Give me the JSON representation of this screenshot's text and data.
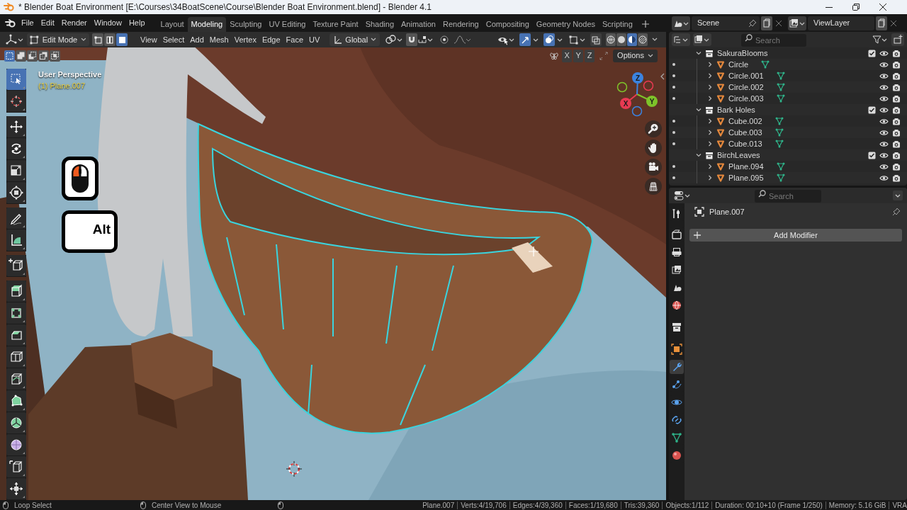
{
  "window": {
    "title": "* Blender Boat Environment [E:\\Courses\\34BoatScene\\Course\\Blender Boat Environment.blend] - Blender 4.1"
  },
  "menu": [
    "File",
    "Edit",
    "Render",
    "Window",
    "Help"
  ],
  "workspaces": [
    {
      "label": "Layout",
      "selected": false
    },
    {
      "label": "Modeling",
      "selected": true
    },
    {
      "label": "Sculpting",
      "selected": false
    },
    {
      "label": "UV Editing",
      "selected": false
    },
    {
      "label": "Texture Paint",
      "selected": false
    },
    {
      "label": "Shading",
      "selected": false
    },
    {
      "label": "Animation",
      "selected": false
    },
    {
      "label": "Rendering",
      "selected": false
    },
    {
      "label": "Compositing",
      "selected": false
    },
    {
      "label": "Geometry Nodes",
      "selected": false
    },
    {
      "label": "Scripting",
      "selected": false
    }
  ],
  "scene": {
    "name": "Scene"
  },
  "view_layer": {
    "name": "ViewLayer"
  },
  "viewport_header": {
    "mode": "Edit Mode",
    "select_modes": [
      {
        "selected": false
      },
      {
        "selected": false
      },
      {
        "selected": true
      }
    ],
    "menus": [
      "View",
      "Select",
      "Add",
      "Mesh",
      "Vertex",
      "Edge",
      "Face",
      "UV"
    ],
    "orientation": "Global",
    "gizmos_on": true,
    "overlays_on": true,
    "shading": [
      {
        "selected": false
      },
      {
        "selected": false
      },
      {
        "selected": true
      },
      {
        "selected": false
      }
    ]
  },
  "select_box_modes": [
    {
      "selected": true
    },
    {
      "selected": false
    },
    {
      "selected": false
    },
    {
      "selected": false
    },
    {
      "selected": false
    }
  ],
  "mirror_axes": [
    {
      "label": "X",
      "on": false
    },
    {
      "label": "Y",
      "on": false
    },
    {
      "label": "Z",
      "on": false
    }
  ],
  "options_label": "Options",
  "viewport": {
    "view_name": "User Perspective",
    "object_info": "(1) Plane.007"
  },
  "toolbar": {
    "groups": [
      [
        {
          "selected": true
        },
        {
          "selected": false
        }
      ],
      [
        {
          "selected": false
        },
        {
          "selected": false
        },
        {
          "selected": false
        },
        {
          "selected": false
        }
      ],
      [
        {
          "selected": false
        },
        {
          "selected": false
        }
      ],
      [
        {
          "selected": false
        }
      ],
      [
        {
          "selected": false
        },
        {
          "selected": false
        },
        {
          "selected": false
        },
        {
          "selected": false
        },
        {
          "selected": false
        },
        {
          "selected": false
        },
        {
          "selected": false
        },
        {
          "selected": false
        },
        {
          "selected": false
        },
        {
          "selected": false
        }
      ]
    ]
  },
  "screencast_keys": {
    "mouse": {
      "left_pressed": true,
      "right_pressed": false
    },
    "keys": [
      {
        "label": "Alt"
      }
    ]
  },
  "nav_gizmo": {
    "axes": [
      {
        "label": "X",
        "color": "#e83a52"
      },
      {
        "label": "Y",
        "color": "#7ec32a"
      },
      {
        "label": "Z",
        "color": "#3b83e0"
      }
    ]
  },
  "outliner": {
    "search_placeholder": "Search",
    "tree": [
      {
        "name": "SakuraBlooms",
        "kind": "collection",
        "expanded": true,
        "checked": true,
        "children": [
          {
            "name": "Circle",
            "kind": "object",
            "expanded": false
          },
          {
            "name": "Circle.001",
            "kind": "object",
            "expanded": false
          },
          {
            "name": "Circle.002",
            "kind": "object",
            "expanded": false
          },
          {
            "name": "Circle.003",
            "kind": "object",
            "expanded": false
          }
        ]
      },
      {
        "name": "Bark Holes",
        "kind": "collection",
        "expanded": true,
        "checked": true,
        "children": [
          {
            "name": "Cube.002",
            "kind": "object",
            "expanded": false
          },
          {
            "name": "Cube.003",
            "kind": "object",
            "expanded": false
          },
          {
            "name": "Cube.013",
            "kind": "object",
            "expanded": false
          }
        ]
      },
      {
        "name": "BirchLeaves",
        "kind": "collection",
        "expanded": true,
        "checked": true,
        "children": [
          {
            "name": "Plane.094",
            "kind": "object",
            "expanded": false
          },
          {
            "name": "Plane.095",
            "kind": "object",
            "expanded": false
          }
        ]
      }
    ]
  },
  "properties": {
    "search_placeholder": "Search",
    "tabs": [
      {
        "selected": false
      },
      {
        "selected": false
      },
      {
        "selected": false
      },
      {
        "selected": false
      },
      {
        "selected": false
      },
      {
        "selected": false
      },
      {
        "selected": false
      },
      {
        "selected": false
      },
      {
        "selected": true
      },
      {
        "selected": false
      },
      {
        "selected": false
      },
      {
        "selected": false
      },
      {
        "selected": false
      },
      {
        "selected": false
      }
    ],
    "object_name": "Plane.007",
    "add_modifier": "Add Modifier"
  },
  "status_bar": {
    "hints": [
      {
        "label": "Loop Select"
      },
      {
        "label": "Center View to Mouse"
      }
    ],
    "stats": [
      "Plane.007",
      "Verts:4/19,706",
      "Edges:4/39,360",
      "Faces:1/19,680",
      "Tris:39,360",
      "Objects:1/112",
      "Duration: 00:10+10 (Frame 1/250)",
      "Memory: 5.16 GiB",
      "VRA"
    ]
  }
}
